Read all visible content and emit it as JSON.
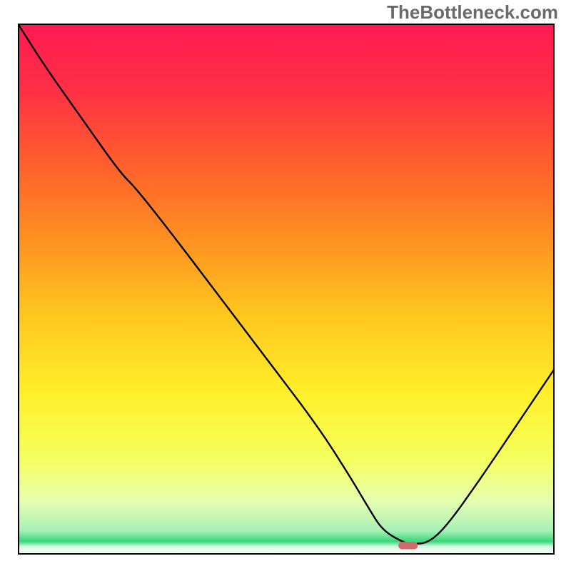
{
  "watermark": "TheBottleneck.com",
  "chart_data": {
    "type": "line",
    "title": "",
    "xlabel": "",
    "ylabel": "",
    "xlim": [
      0,
      100
    ],
    "ylim": [
      0,
      100
    ],
    "grid": false,
    "gradient_background": {
      "stops": [
        {
          "offset": 0.0,
          "color": "#ff1a52"
        },
        {
          "offset": 0.12,
          "color": "#ff2e46"
        },
        {
          "offset": 0.25,
          "color": "#ff5a2e"
        },
        {
          "offset": 0.4,
          "color": "#ff8e22"
        },
        {
          "offset": 0.55,
          "color": "#ffc71e"
        },
        {
          "offset": 0.7,
          "color": "#fff02a"
        },
        {
          "offset": 0.82,
          "color": "#f5ff5e"
        },
        {
          "offset": 0.9,
          "color": "#e6ffb0"
        },
        {
          "offset": 0.955,
          "color": "#a7f0b8"
        },
        {
          "offset": 0.975,
          "color": "#38d878"
        },
        {
          "offset": 0.985,
          "color": "#d6f7e2"
        },
        {
          "offset": 1.0,
          "color": "#ffffff"
        }
      ]
    },
    "series": [
      {
        "name": "bottleneck-curve",
        "color": "#000000",
        "x": [
          0.0,
          5.0,
          12.0,
          19.0,
          22.0,
          29.0,
          38.0,
          47.0,
          56.0,
          62.0,
          65.5,
          68.0,
          72.0,
          73.5,
          76.5,
          80.0,
          86.0,
          92.0,
          100.0
        ],
        "y": [
          100.0,
          92.0,
          82.0,
          72.0,
          69.0,
          60.0,
          48.0,
          36.0,
          24.0,
          14.5,
          8.5,
          4.5,
          2.2,
          2.0,
          2.2,
          5.5,
          14.0,
          23.0,
          35.0
        ]
      }
    ],
    "marker": {
      "name": "minimum-marker",
      "x": 72.7,
      "y": 1.7,
      "width": 3.6,
      "height": 1.4,
      "color": "#d06a6c"
    },
    "frame": true
  }
}
